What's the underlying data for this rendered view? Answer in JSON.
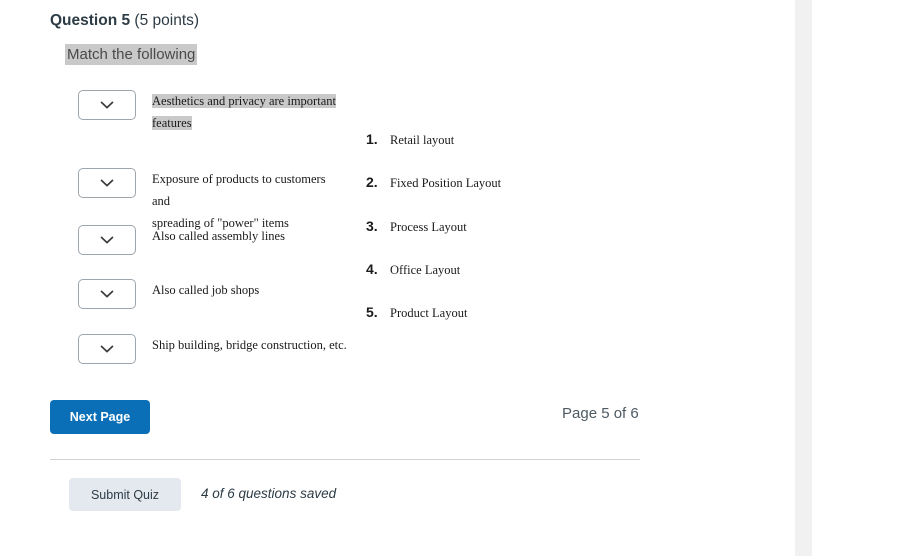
{
  "question": {
    "title": "Question 5",
    "points": "(5 points)",
    "prompt": "Match the following"
  },
  "match_items": [
    {
      "dropdown_value": "",
      "dropdown_placeholder": "",
      "text_line1": "Aesthetics and privacy are important",
      "text_line2": "features",
      "highlighted": true
    },
    {
      "dropdown_value": "",
      "dropdown_placeholder": "",
      "text_line1": "Exposure of products to customers and",
      "text_line2": "spreading of \"power\" items",
      "highlighted": false
    },
    {
      "dropdown_value": "",
      "dropdown_placeholder": "",
      "text_line1": "Also called assembly lines",
      "text_line2": "",
      "highlighted": false
    },
    {
      "dropdown_value": "",
      "dropdown_placeholder": "",
      "text_line1": "Also called job shops",
      "text_line2": "",
      "highlighted": false
    },
    {
      "dropdown_value": "",
      "dropdown_placeholder": "",
      "text_line1": "Ship building, bridge construction, etc.",
      "text_line2": "",
      "highlighted": false
    }
  ],
  "options": [
    {
      "number": "1.",
      "label": "Retail layout"
    },
    {
      "number": "2.",
      "label": "Fixed Position Layout"
    },
    {
      "number": "3.",
      "label": "Process Layout"
    },
    {
      "number": "4.",
      "label": "Office Layout"
    },
    {
      "number": "5.",
      "label": "Product Layout"
    }
  ],
  "footer": {
    "next_page_label": "Next Page",
    "page_indicator": "Page 5 of 6",
    "submit_label": "Submit Quiz",
    "saved_status": "4 of 6 questions saved"
  },
  "colors": {
    "primary_button": "#0a6fb7",
    "submit_button": "#e4e9f0",
    "selection_highlight": "#c9c9c9",
    "divider": "#cfd4d9",
    "gutter": "#f1f1f1"
  },
  "icons": {
    "chevron_down": "chevron-down-icon"
  }
}
